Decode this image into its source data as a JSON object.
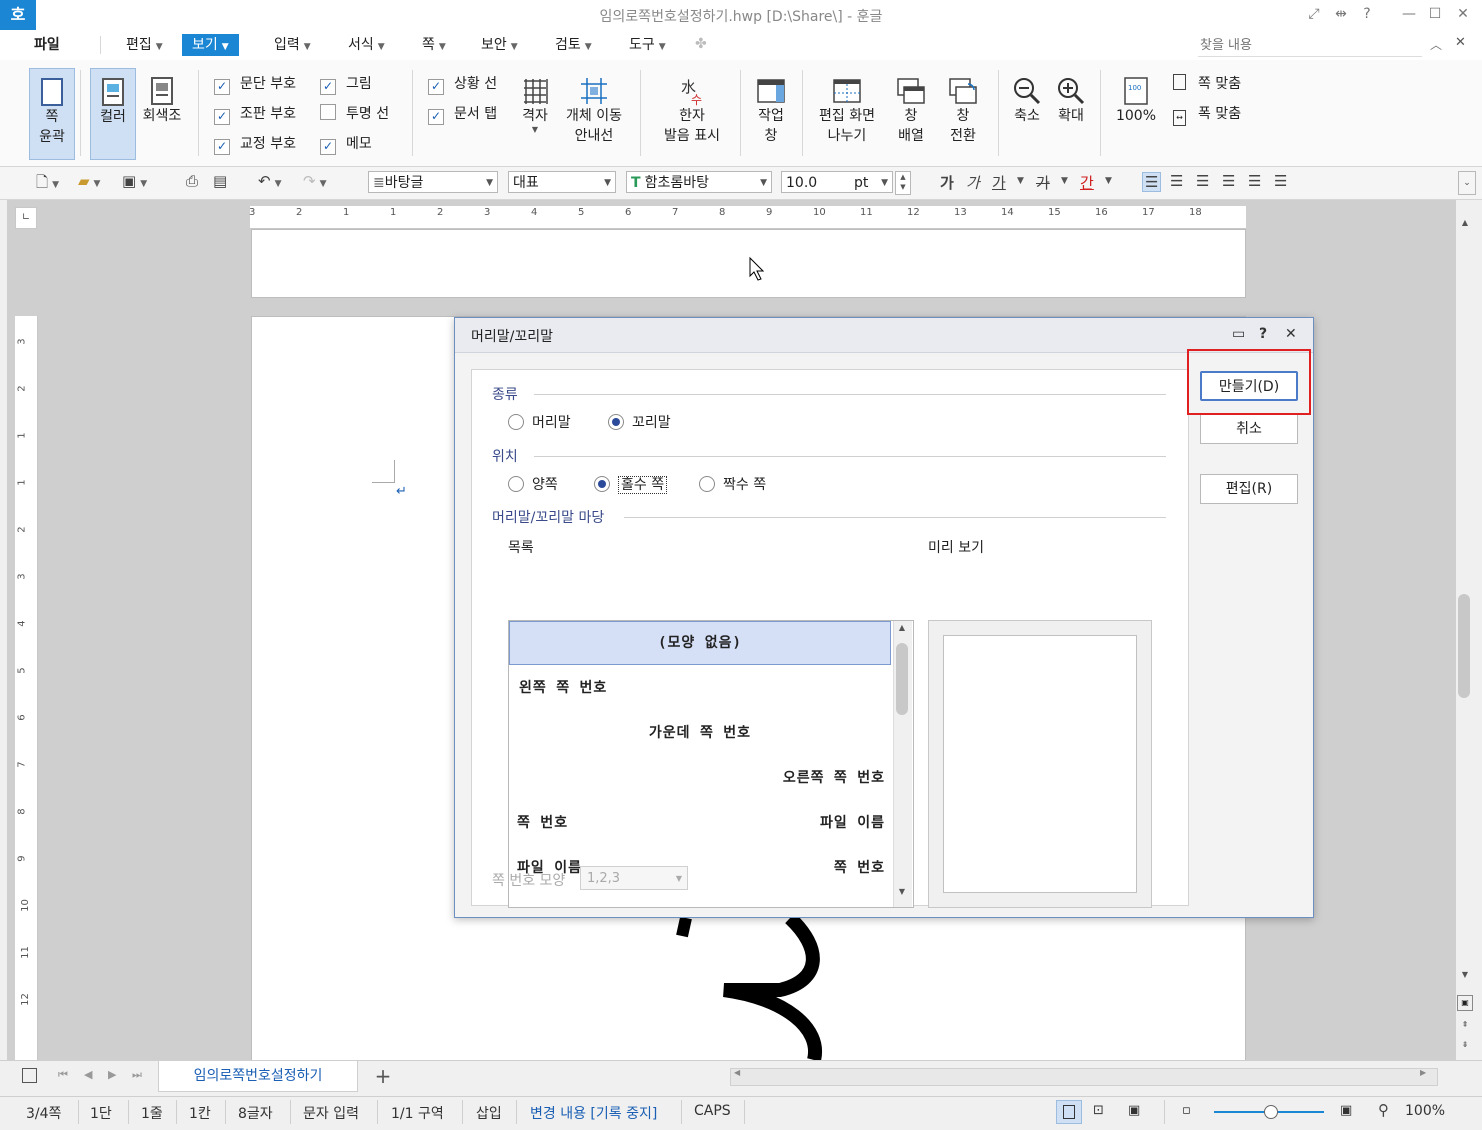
{
  "window": {
    "app_logo": "호",
    "title": "임의로쪽번호설정하기.hwp [D:\\Share\\] - 훈글",
    "controls": [
      "⤢",
      "⇹",
      "?",
      "—",
      "☐",
      "✕"
    ]
  },
  "menubar": {
    "items": [
      "파일",
      "편집",
      "보기",
      "입력",
      "서식",
      "쪽",
      "보안",
      "검토",
      "도구"
    ],
    "active": "보기",
    "search_placeholder": "찾을 내용"
  },
  "ribbon": {
    "page_outline": "쪽\n윤곽",
    "color": "컬러",
    "grayscale": "회색조",
    "checks_col1": [
      {
        "label": "문단 부호",
        "checked": true
      },
      {
        "label": "조판 부호",
        "checked": true
      },
      {
        "label": "교정 부호",
        "checked": true
      }
    ],
    "checks_col2": [
      {
        "label": "그림",
        "checked": true
      },
      {
        "label": "투명 선",
        "checked": false
      },
      {
        "label": "메모",
        "checked": true
      }
    ],
    "checks_col3": [
      {
        "label": "상황 선",
        "checked": true
      },
      {
        "label": "문서 탭",
        "checked": true
      }
    ],
    "grid": "격자",
    "object_move": "개체 이동\n안내선",
    "hanja": "한자\n발음 표시",
    "task_pane": "작업\n창",
    "split_view": "편집 화면\n나누기",
    "arrange": "창\n배열",
    "switch": "창\n전환",
    "zoom_out": "축소",
    "zoom_in": "확대",
    "zoom_100": "100%",
    "fit_page": "쪽 맞춤",
    "fit_width": "폭 맞춤"
  },
  "toolbar": {
    "style": "바탕글",
    "language": "대표",
    "font": "함초롬바탕",
    "size": "10.0",
    "unit": "pt",
    "bold": "가",
    "italic": "가",
    "underline": "가",
    "strike": "가",
    "color": "간"
  },
  "ruler": {
    "h_labels": [
      "3",
      "2",
      "1",
      "1",
      "2",
      "3",
      "4",
      "5",
      "6",
      "7",
      "8",
      "9",
      "10",
      "11",
      "12",
      "13",
      "14",
      "15",
      "16",
      "17",
      "18"
    ],
    "v_labels": [
      "3",
      "2",
      "1",
      "1",
      "2",
      "3",
      "4",
      "5",
      "6",
      "7",
      "8",
      "9",
      "10",
      "11",
      "12"
    ]
  },
  "dialog": {
    "title": "머리말/꼬리말",
    "type_section": "종류",
    "type_options": [
      {
        "label": "머리말",
        "selected": false
      },
      {
        "label": "꼬리말",
        "selected": true
      }
    ],
    "position_section": "위치",
    "position_options": [
      {
        "label": "양쪽",
        "selected": false
      },
      {
        "label": "홀수 쪽",
        "selected": true
      },
      {
        "label": "짝수 쪽",
        "selected": false
      }
    ],
    "gallery_section": "머리말/꼬리말 마당",
    "list_label": "목록",
    "preview_label": "미리 보기",
    "list_items": [
      "(모양 없음)",
      "왼쪽 쪽 번호",
      "가운데 쪽 번호",
      "오른쪽 쪽 번호",
      "쪽 번호",
      "파일 이름",
      "파일 이름",
      "쪽 번호"
    ],
    "page_number_format_label": "쪽 번호 모양",
    "page_number_format_value": "1,2,3",
    "buttons": {
      "create": "만들기(D)",
      "cancel": "취소",
      "edit": "편집(R)"
    }
  },
  "tabs": {
    "document_tab": "임의로쪽번호설정하기",
    "add": "+"
  },
  "status": {
    "page": "3/4쪽",
    "column": "1단",
    "line": "1줄",
    "char_col": "1칸",
    "chars": "8글자",
    "input_mode": "문자 입력",
    "section": "1/1 구역",
    "insert": "삽입",
    "track_changes": "변경 내용 [기록 중지]",
    "caps": "CAPS",
    "zoom": "100%"
  },
  "colors": {
    "accent": "#1a86d4",
    "highlight_box": "#e02020",
    "list_selection": "#d5dff5"
  }
}
